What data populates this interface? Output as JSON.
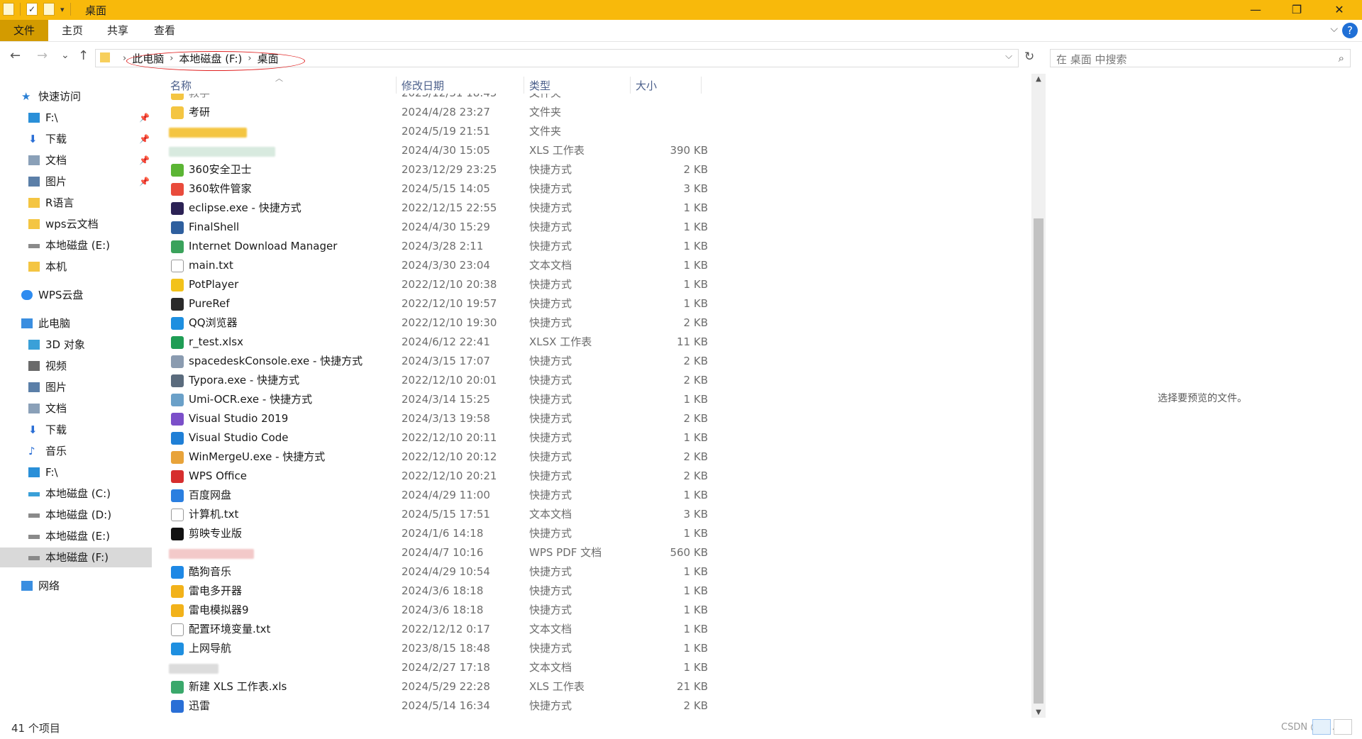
{
  "window": {
    "title": "桌面",
    "min_glyph": "—",
    "max_glyph": "❐",
    "close_glyph": "✕"
  },
  "ribbon": {
    "file": "文件",
    "home": "主页",
    "share": "共享",
    "view": "查看",
    "help": "?",
    "expand": "⌵"
  },
  "nav": {
    "back": "←",
    "forward": "→",
    "recent": "⌄",
    "up": "↑",
    "refresh": "↻",
    "dropdown": "⌵"
  },
  "address": {
    "crumbs": [
      "此电脑",
      "本地磁盘 (F:)",
      "桌面"
    ],
    "sep": "›"
  },
  "search": {
    "placeholder": "在 桌面 中搜索",
    "icon": "⌕"
  },
  "sidebar": [
    {
      "label": "快速访问",
      "icon": "star-icon",
      "color": "#2a7fd4"
    },
    {
      "label": "F:\\",
      "icon": "drive-icon",
      "color": "#2a8fd8",
      "pinned": true
    },
    {
      "label": "下载",
      "icon": "download-icon",
      "color": "#2b6fd6",
      "pinned": true
    },
    {
      "label": "文档",
      "icon": "document-icon",
      "color": "#8aa0b8",
      "pinned": true
    },
    {
      "label": "图片",
      "icon": "pictures-icon",
      "color": "#5b7fa8",
      "pinned": true
    },
    {
      "label": "R语言",
      "icon": "folder-icon",
      "color": "#f4c542"
    },
    {
      "label": "wps云文档",
      "icon": "folder-icon",
      "color": "#f4c542"
    },
    {
      "label": "本地磁盘 (E:)",
      "icon": "disk-icon",
      "color": "#8a8a8a"
    },
    {
      "label": "本机",
      "icon": "folder-icon",
      "color": "#f4c542"
    },
    {
      "label": "WPS云盘",
      "icon": "cloud-icon",
      "color": "#2f8cf0"
    },
    {
      "label": "此电脑",
      "icon": "computer-icon",
      "color": "#3a8ee0"
    },
    {
      "label": "3D 对象",
      "icon": "cube-icon",
      "color": "#3aa0d8"
    },
    {
      "label": "视频",
      "icon": "video-icon",
      "color": "#6a6a6a"
    },
    {
      "label": "图片",
      "icon": "pictures-icon",
      "color": "#5b7fa8"
    },
    {
      "label": "文档",
      "icon": "document-icon",
      "color": "#8aa0b8"
    },
    {
      "label": "下载",
      "icon": "download-icon",
      "color": "#2b6fd6"
    },
    {
      "label": "音乐",
      "icon": "music-icon",
      "color": "#2b6fd6"
    },
    {
      "label": "F:\\",
      "icon": "drive-icon",
      "color": "#2a8fd8"
    },
    {
      "label": "本地磁盘 (C:)",
      "icon": "disk-icon",
      "color": "#3aa0d8"
    },
    {
      "label": "本地磁盘 (D:)",
      "icon": "disk-icon",
      "color": "#8a8a8a"
    },
    {
      "label": "本地磁盘 (E:)",
      "icon": "disk-icon",
      "color": "#8a8a8a"
    },
    {
      "label": "本地磁盘 (F:)",
      "icon": "disk-icon",
      "color": "#8a8a8a",
      "selected": true
    },
    {
      "label": "网络",
      "icon": "network-icon",
      "color": "#3a8ee0"
    }
  ],
  "columns": {
    "name": "名称",
    "date": "修改日期",
    "type": "类型",
    "size": "大小"
  },
  "files": [
    {
      "name": "考研",
      "date": "2024/4/28 23:27",
      "type": "文件夹",
      "size": "",
      "icon": "folder-icon",
      "color": "#f4c542"
    },
    {
      "name": "",
      "date": "2024/5/19 21:51",
      "type": "文件夹",
      "size": "",
      "icon": "folder-icon",
      "color": "#f4c542",
      "redacted": true
    },
    {
      "name": "",
      "date": "2024/4/30 15:05",
      "type": "XLS 工作表",
      "size": "390 KB",
      "icon": "spreadsheet-icon",
      "color": "#d8eadf",
      "redacted": true
    },
    {
      "name": "360安全卫士",
      "date": "2023/12/29 23:25",
      "type": "快捷方式",
      "size": "2 KB",
      "icon": "shield-app-icon",
      "color": "#5bb534"
    },
    {
      "name": "360软件管家",
      "date": "2024/5/15 14:05",
      "type": "快捷方式",
      "size": "3 KB",
      "icon": "app-store-icon",
      "color": "#e94b3c"
    },
    {
      "name": "eclipse.exe - 快捷方式",
      "date": "2022/12/15 22:55",
      "type": "快捷方式",
      "size": "1 KB",
      "icon": "eclipse-icon",
      "color": "#2c2255"
    },
    {
      "name": "FinalShell",
      "date": "2024/4/30 15:29",
      "type": "快捷方式",
      "size": "1 KB",
      "icon": "terminal-icon",
      "color": "#2f5f9e"
    },
    {
      "name": "Internet Download Manager",
      "date": "2024/3/28 2:11",
      "type": "快捷方式",
      "size": "1 KB",
      "icon": "download-manager-icon",
      "color": "#3aa25b"
    },
    {
      "name": "main.txt",
      "date": "2024/3/30 23:04",
      "type": "文本文档",
      "size": "1 KB",
      "icon": "text-file-icon",
      "color": "#ffffff"
    },
    {
      "name": "PotPlayer",
      "date": "2022/12/10 20:38",
      "type": "快捷方式",
      "size": "1 KB",
      "icon": "player-icon",
      "color": "#f2c21a"
    },
    {
      "name": "PureRef",
      "date": "2022/12/10 19:57",
      "type": "快捷方式",
      "size": "1 KB",
      "icon": "pureref-icon",
      "color": "#2a2a2a"
    },
    {
      "name": "QQ浏览器",
      "date": "2022/12/10 19:30",
      "type": "快捷方式",
      "size": "2 KB",
      "icon": "browser-icon",
      "color": "#1e8fe0"
    },
    {
      "name": "r_test.xlsx",
      "date": "2024/6/12 22:41",
      "type": "XLSX 工作表",
      "size": "11 KB",
      "icon": "excel-icon",
      "color": "#1f9d55"
    },
    {
      "name": "spacedeskConsole.exe - 快捷方式",
      "date": "2024/3/15 17:07",
      "type": "快捷方式",
      "size": "2 KB",
      "icon": "app-icon",
      "color": "#8a9bb0"
    },
    {
      "name": "Typora.exe - 快捷方式",
      "date": "2022/12/10 20:01",
      "type": "快捷方式",
      "size": "2 KB",
      "icon": "typora-icon",
      "color": "#5a6b7d"
    },
    {
      "name": "Umi-OCR.exe - 快捷方式",
      "date": "2024/3/14 15:25",
      "type": "快捷方式",
      "size": "1 KB",
      "icon": "ocr-icon",
      "color": "#6aa0c8"
    },
    {
      "name": "Visual Studio 2019",
      "date": "2024/3/13 19:58",
      "type": "快捷方式",
      "size": "2 KB",
      "icon": "visual-studio-icon",
      "color": "#7b4fc9"
    },
    {
      "name": "Visual Studio Code",
      "date": "2022/12/10 20:11",
      "type": "快捷方式",
      "size": "1 KB",
      "icon": "vscode-icon",
      "color": "#1f7fd6"
    },
    {
      "name": "WinMergeU.exe - 快捷方式",
      "date": "2022/12/10 20:12",
      "type": "快捷方式",
      "size": "2 KB",
      "icon": "winmerge-icon",
      "color": "#e8a33a"
    },
    {
      "name": "WPS Office",
      "date": "2022/12/10 20:21",
      "type": "快捷方式",
      "size": "2 KB",
      "icon": "wps-icon",
      "color": "#d62e2e"
    },
    {
      "name": "百度网盘",
      "date": "2024/4/29 11:00",
      "type": "快捷方式",
      "size": "1 KB",
      "icon": "cloud-drive-icon",
      "color": "#2b7fe0"
    },
    {
      "name": "计算机.txt",
      "date": "2024/5/15 17:51",
      "type": "文本文档",
      "size": "3 KB",
      "icon": "text-file-icon",
      "color": "#ffffff"
    },
    {
      "name": "剪映专业版",
      "date": "2024/1/6 14:18",
      "type": "快捷方式",
      "size": "1 KB",
      "icon": "video-editor-icon",
      "color": "#111111"
    },
    {
      "name": "",
      "date": "2024/4/7 10:16",
      "type": "WPS PDF 文档",
      "size": "560 KB",
      "icon": "pdf-icon",
      "color": "#f3c9c9",
      "redacted": true
    },
    {
      "name": "酷狗音乐",
      "date": "2024/4/29 10:54",
      "type": "快捷方式",
      "size": "1 KB",
      "icon": "music-app-icon",
      "color": "#1e88e5"
    },
    {
      "name": "雷电多开器",
      "date": "2024/3/6 18:18",
      "type": "快捷方式",
      "size": "1 KB",
      "icon": "emulator-icon",
      "color": "#f2b21a"
    },
    {
      "name": "雷电模拟器9",
      "date": "2024/3/6 18:18",
      "type": "快捷方式",
      "size": "1 KB",
      "icon": "emulator-icon",
      "color": "#f2b21a"
    },
    {
      "name": "配置环境变量.txt",
      "date": "2022/12/12 0:17",
      "type": "文本文档",
      "size": "1 KB",
      "icon": "text-file-icon",
      "color": "#ffffff"
    },
    {
      "name": "上网导航",
      "date": "2023/8/15 18:48",
      "type": "快捷方式",
      "size": "1 KB",
      "icon": "browser-icon",
      "color": "#1e8fe0"
    },
    {
      "name": "",
      "date": "2024/2/27 17:18",
      "type": "文本文档",
      "size": "1 KB",
      "icon": "text-file-icon",
      "color": "#ffffff",
      "redacted": true
    },
    {
      "name": "新建 XLS 工作表.xls",
      "date": "2024/5/29 22:28",
      "type": "XLS 工作表",
      "size": "21 KB",
      "icon": "spreadsheet-icon",
      "color": "#3aa86b"
    },
    {
      "name": "迅雷",
      "date": "2024/5/14 16:34",
      "type": "快捷方式",
      "size": "2 KB",
      "icon": "thunder-icon",
      "color": "#2a6fd6"
    }
  ],
  "preview": {
    "message": "选择要预览的文件。"
  },
  "status": {
    "count": "41 个项目"
  },
  "watermark": "CSDN @C..."
}
